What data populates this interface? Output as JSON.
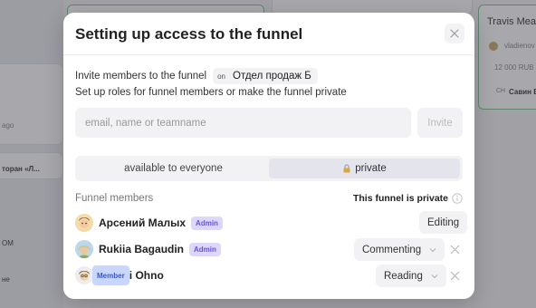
{
  "background": {
    "card_title": "Travis Meat",
    "card_user": "vladienov",
    "card_amount": "12 000 RUB",
    "card_tag_prefix": "СН",
    "card_tag": "Савин В",
    "left_ago": "ago",
    "left_restaurant": "торан «Л...",
    "left_om": "ОМ",
    "left_ne": "не"
  },
  "modal": {
    "title": "Setting up access to the funnel",
    "invite_text": "Invite members to the funnel",
    "funnel_prefix": "on",
    "funnel_name": "Отдел продаж Б",
    "roles_text": "Set up roles for funnel members or make the funnel private",
    "search_placeholder": "email, name or teamname",
    "invite_button": "Invite",
    "visibility_options": [
      "available to everyone",
      "private"
    ],
    "visibility_selected": "private",
    "members_label": "Funnel members",
    "private_label": "This funnel is private",
    "members": [
      {
        "name": "Арсений Малых",
        "badge": "Admin",
        "role": "Editing",
        "removable": false
      },
      {
        "name": "Rukiia Bagaudin",
        "badge": "Admin",
        "role": "Commenting",
        "removable": true
      },
      {
        "name": "Taiichi Ohno",
        "badge": "Member",
        "role": "Reading",
        "removable": true
      }
    ]
  },
  "colors": {
    "admin_badge": "#ddd6ff",
    "member_badge": "#c9d6ff",
    "overlay": "#3c3c46"
  }
}
